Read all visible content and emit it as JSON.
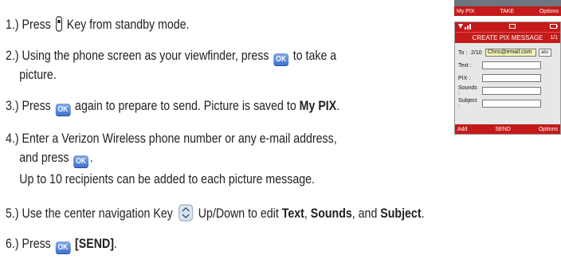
{
  "steps": {
    "s1": {
      "before": "1.) Press",
      "after": "Key from standby mode."
    },
    "s2": {
      "l1a": "2.) Using the phone screen as your viewfinder, press",
      "l1b": "to take a",
      "l2": "picture."
    },
    "s3": {
      "before": "3.) Press",
      "mid": "again to prepare to send. Picture is saved to",
      "bold": "My PIX",
      "end": "."
    },
    "s4": {
      "l1": "4.) Enter a Verizon Wireless phone number or any e-mail address,",
      "l2": "and press",
      "l2end": ".",
      "l3": "Up to 10 recipients can be added to each picture message."
    },
    "s5": {
      "before": "5.) Use the center navigation Key",
      "mid": "Up/Down to edit",
      "b1": "Text",
      "c1": ",",
      "b2": "Sounds",
      "c2": ", and",
      "b3": "Subject",
      "end": "."
    },
    "s6": {
      "before": "6.) Press",
      "bold": "[SEND]",
      "end": "."
    }
  },
  "icons": {
    "ok_label": "OK",
    "camera_key": "camera-key-icon",
    "nav_key": "nav-updown-key-icon"
  },
  "phone_top": {
    "soft_left": "My PIX",
    "soft_center": "TAKE",
    "soft_right": "Options"
  },
  "phone_compose": {
    "status_left": "signal 1X",
    "status_right": "battery",
    "title": "CREATE PIX MESSAGE",
    "page": "1/1",
    "to_label": "To :",
    "to_count": "2/10",
    "to_value": "Chris@email.com",
    "mode": "abc",
    "fields": [
      "Text :",
      "PIX :",
      "Sounds :",
      "Subject :"
    ],
    "soft_left": "Add",
    "soft_center": "SEND",
    "soft_right": "Options"
  },
  "colors": {
    "accent_red": "#c41a1a",
    "ok_blue": "#3d6fd0",
    "text": "#231f20"
  }
}
